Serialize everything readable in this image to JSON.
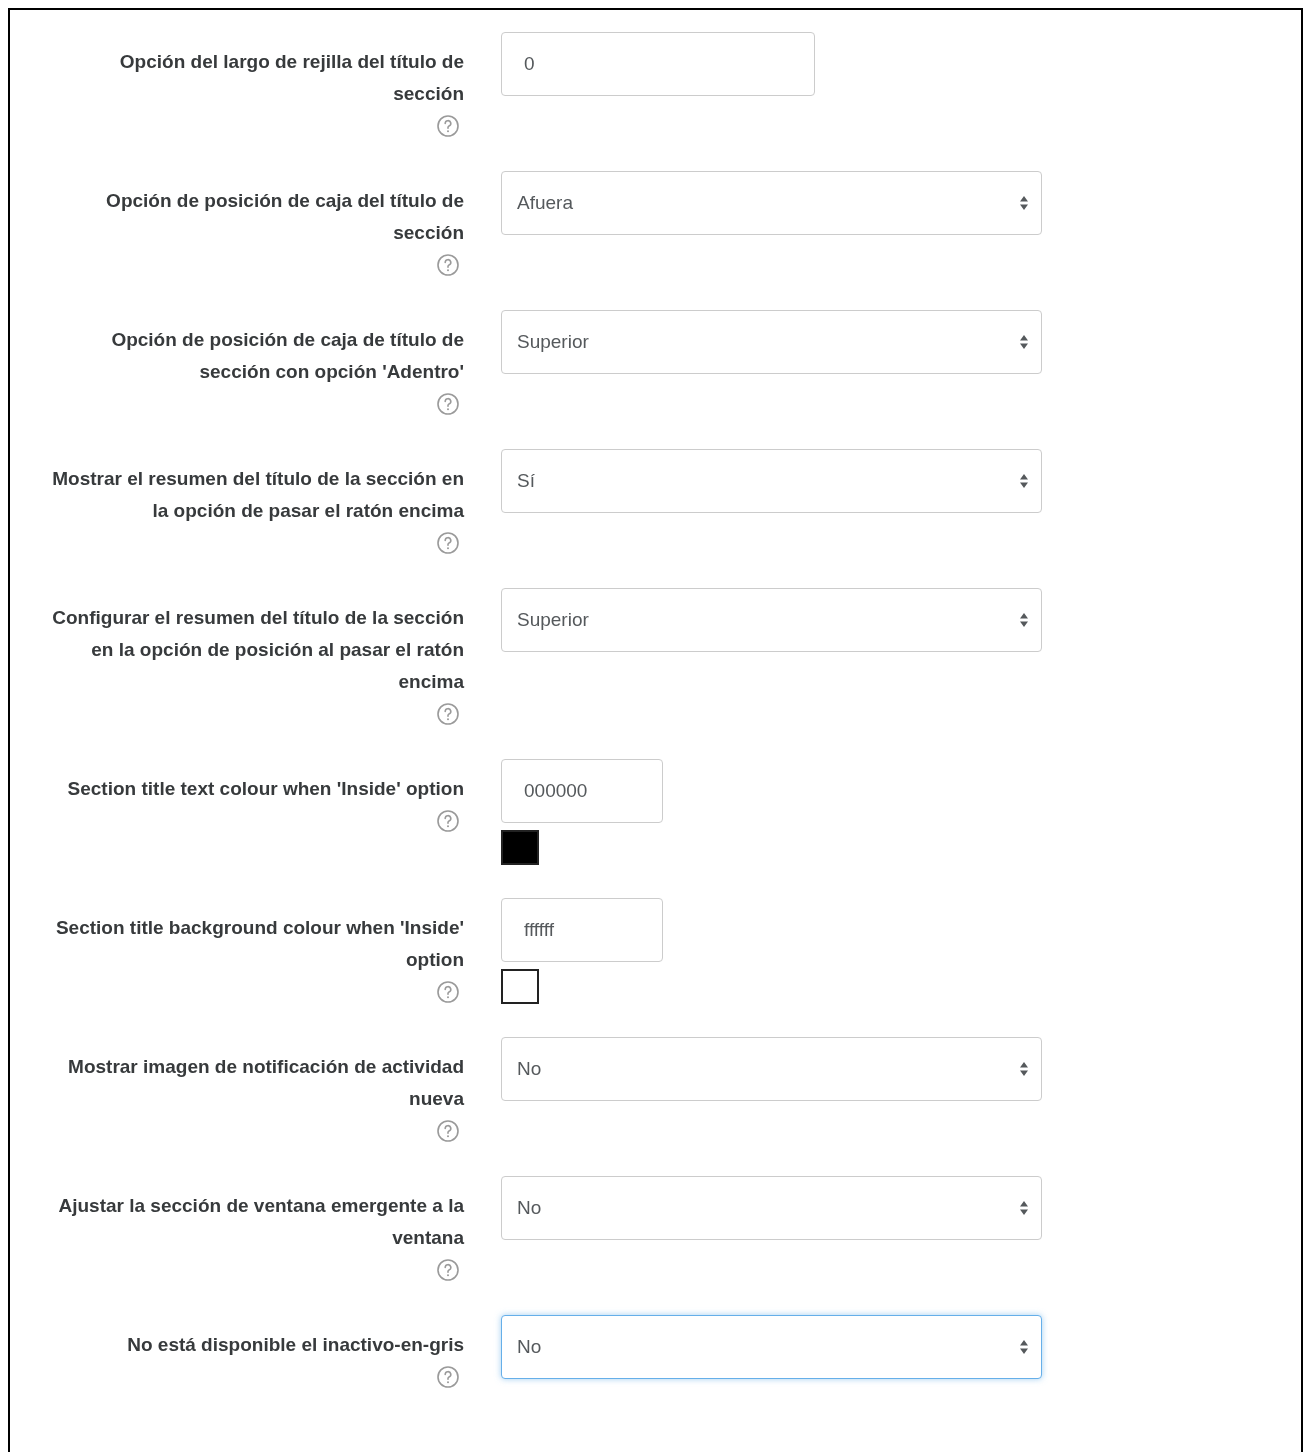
{
  "settings": [
    {
      "label": "Opción del largo de rejilla del título de sección",
      "kind": "text",
      "value": "0",
      "focused": false
    },
    {
      "label": "Opción de posición de caja del título de sección",
      "kind": "select",
      "value": "Afuera",
      "focused": false
    },
    {
      "label": "Opción de posición de caja de título de sección con opción 'Adentro'",
      "kind": "select",
      "value": "Superior",
      "focused": false
    },
    {
      "label": "Mostrar el resumen del título de la sección en la opción de pasar el ratón encima",
      "kind": "select",
      "value": "Sí",
      "focused": false
    },
    {
      "label": "Configurar el resumen del título de la sección en la opción de posición al pasar el ratón encima",
      "kind": "select",
      "value": "Superior",
      "focused": false
    },
    {
      "label": "Section title text colour when 'Inside' option",
      "kind": "color",
      "value": "000000",
      "color": "#000000",
      "focused": false
    },
    {
      "label": "Section title background colour when 'Inside' option",
      "kind": "color",
      "value": "ffffff",
      "color": "#ffffff",
      "focused": false
    },
    {
      "label": "Mostrar imagen de notificación de actividad nueva",
      "kind": "select",
      "value": "No",
      "focused": false
    },
    {
      "label": "Ajustar la sección de ventana emergente a la ventana",
      "kind": "select",
      "value": "No",
      "focused": false
    },
    {
      "label": "No está disponible el inactivo-en-gris",
      "kind": "select",
      "value": "No",
      "focused": true
    }
  ]
}
